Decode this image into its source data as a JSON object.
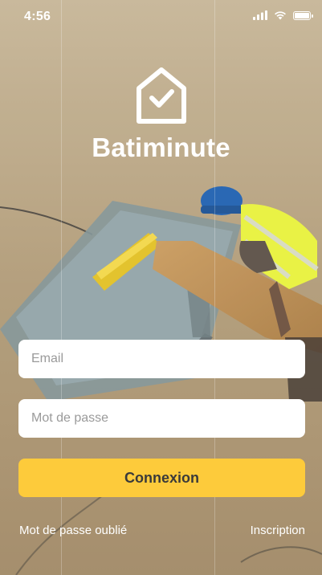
{
  "status_bar": {
    "time": "4:56",
    "icons": [
      "signal-icon",
      "wifi-icon",
      "battery-icon"
    ],
    "battery_level": 1.0
  },
  "app": {
    "name": "Batiminute",
    "logo_icon": "house-check-icon"
  },
  "login": {
    "email_placeholder": "Email",
    "email_value": "",
    "password_placeholder": "Mot de passe",
    "password_value": "",
    "submit_label": "Connexion",
    "forgot_password_label": "Mot de passe oublié",
    "signup_label": "Inscription"
  },
  "colors": {
    "accent": "#fdcb3b",
    "button_text": "#3a3a3a",
    "field_background": "#ffffff",
    "text_on_background": "#ffffff"
  }
}
